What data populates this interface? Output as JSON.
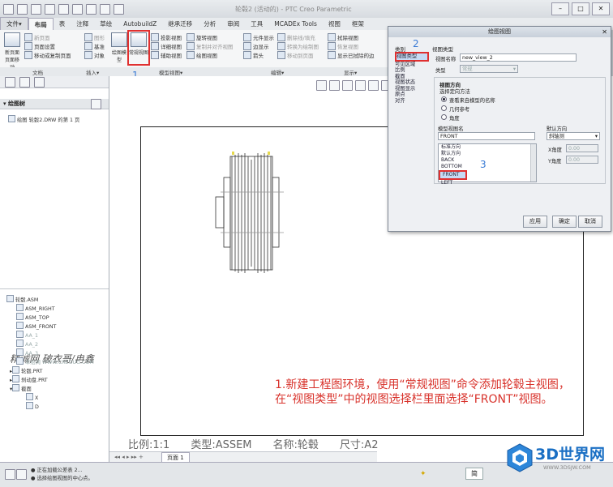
{
  "window": {
    "title": "轮毂2 (活动的) - PTC Creo Parametric",
    "close_glyph": "✕"
  },
  "tabs": [
    {
      "label": "文件▾"
    },
    {
      "label": "布局"
    },
    {
      "label": "表"
    },
    {
      "label": "注释"
    },
    {
      "label": "草绘"
    },
    {
      "label": "AutobuildZ"
    },
    {
      "label": "继承迁移"
    },
    {
      "label": "分析"
    },
    {
      "label": "审阅"
    },
    {
      "label": "工具"
    },
    {
      "label": "MCADEx Tools"
    },
    {
      "label": "视图"
    },
    {
      "label": "框架"
    }
  ],
  "ribbon": {
    "doc_group": {
      "big": "新页面 页面移动",
      "items": [
        "新页面",
        "页面设置",
        "移动或复制页面"
      ]
    },
    "insert_group": {
      "items": [
        "图形",
        "基准",
        "对象"
      ]
    },
    "model_view_group": {
      "big1": "绘图模型",
      "big2": "常规视图",
      "col1": [
        "投影视图",
        "详细视图",
        "辅助视图"
      ],
      "col2": [
        "旋转视图",
        "复制并对齐视图",
        "绘图视图"
      ]
    },
    "edit_group": {
      "col1": [
        "元件显示",
        "边显示",
        "箭头"
      ],
      "col2": [
        "删除线/填充",
        "转换为绘制图",
        "移动到页面"
      ]
    },
    "display_group": {
      "col1": [
        "拭除视图",
        "恢复视图",
        "显示已拭除的边"
      ]
    },
    "group_labels": {
      "doc": "文档",
      "insert": "插入▾",
      "model_views": "模型视图▾",
      "edit": "编辑▾",
      "display": "显示▾"
    }
  },
  "left_panel": {
    "drawing_tree_header": "绘图树",
    "sheet_item": "绘图 轮毂2.DRW 的第 1 页",
    "model_tree": [
      {
        "label": "轮毂.ASM",
        "grey": false,
        "indent": 0
      },
      {
        "label": "ASM_RIGHT",
        "grey": false,
        "indent": 1
      },
      {
        "label": "ASM_TOP",
        "grey": false,
        "indent": 1
      },
      {
        "label": "ASM_FRONT",
        "grey": false,
        "indent": 1
      },
      {
        "label": "AA_1",
        "grey": true,
        "indent": 1
      },
      {
        "label": "AA_2",
        "grey": true,
        "indent": 1
      },
      {
        "label": "AA_3",
        "grey": true,
        "indent": 1
      },
      {
        "label": "草绘网 WWW.CREOUG.COM",
        "grey": true,
        "indent": 1
      },
      {
        "label": "轮毂.PRT",
        "grey": false,
        "indent": 1
      },
      {
        "label": "刹动盘.PRT",
        "grey": false,
        "indent": 1
      },
      {
        "label": "截面",
        "grey": false,
        "indent": 1
      },
      {
        "label": "X",
        "grey": false,
        "indent": 2
      },
      {
        "label": "D",
        "grey": false,
        "indent": 2
      }
    ]
  },
  "canvas": {
    "watermark": "精诚网 破衣哥/冉鑫",
    "caption_line1": "1.新建工程图环境，使用“常规视图”命令添加轮毂主视图，",
    "caption_line2": "在“视图类型”中的视图选择栏里面选择“FRONT”视图。",
    "scale": "比例:1:1",
    "type": "类型:ASSEM",
    "name": "名称:轮毂",
    "size": "尺寸:A2",
    "page_tab": "页面 1"
  },
  "status": {
    "line1": "● 正在加载公差表 2...",
    "line2": "● 选择绘图视图的中心点。"
  },
  "dialog": {
    "title": "绘图视图",
    "category_label": "类别",
    "categories": [
      "视图类型",
      "可见区域",
      "比例",
      "截面",
      "视图状态",
      "视图显示",
      "原点",
      "对齐"
    ],
    "view_type_label": "视图类型",
    "view_name_label": "视图名称",
    "view_name_value": "new_view_2",
    "type_label": "类型",
    "type_value": "常规",
    "orientation_header": "视图方向",
    "orient_method_label": "选择定向方法",
    "orient_options": [
      "查看来自模型的名称",
      "几何参考",
      "角度"
    ],
    "model_view_name_label": "模型视图名",
    "model_view_name_value": "FRONT",
    "view_list": [
      "标准方向",
      "默认方向",
      "BACK",
      "BOTTOM",
      "FRONT",
      "LEFT"
    ],
    "selected_view": "FRONT",
    "default_orient_label": "默认方向",
    "default_orient_value": "斜轴测",
    "x_angle_label": "X角度",
    "x_angle_value": "0.00",
    "y_angle_label": "Y角度",
    "y_angle_value": "0.00",
    "apply": "应用",
    "ok": "确定",
    "cancel": "取消"
  },
  "annotations": {
    "n1": "1",
    "n2": "2",
    "n3": "3"
  },
  "logo": {
    "text": "3D世界网",
    "url": "WWW.3DSJW.COM"
  },
  "colors": {
    "caption_red": "#d8322b",
    "annotation_blue": "#3a7bd5",
    "highlight_red": "#e03030",
    "logo_blue": "#1a6fc4"
  }
}
